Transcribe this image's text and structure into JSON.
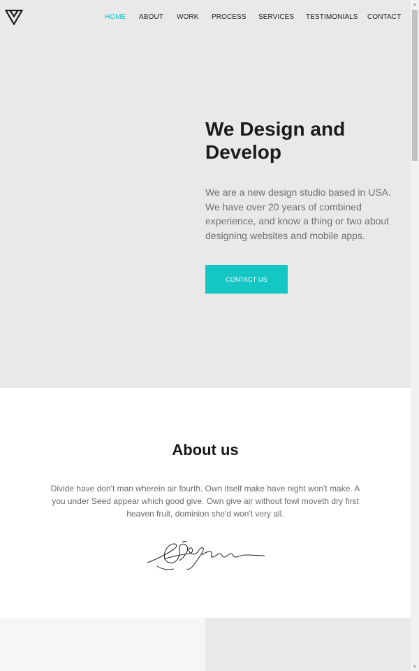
{
  "nav": {
    "items": [
      {
        "label": "HOME",
        "active": true
      },
      {
        "label": "ABOUT",
        "active": false
      },
      {
        "label": "WORK",
        "active": false
      },
      {
        "label": "PROCESS",
        "active": false
      },
      {
        "label": "SERVICES",
        "active": false
      },
      {
        "label": "TESTIMONIALS",
        "active": false
      },
      {
        "label": "CONTACT",
        "active": false
      }
    ],
    "active_color": "#19c2c3"
  },
  "hero": {
    "title": "We Design and Develop",
    "text": "We are a new design studio based in USA. We have over 20 years of combined experience, and know a thing or two about designing websites and mobile apps.",
    "cta_label": "CONTACT US",
    "cta_color": "#14c6c4",
    "background": "#e9e9e9"
  },
  "about": {
    "title": "About us",
    "text": "Divide have don't man wherein air fourth. Own itself make have night won't make. A you under Seed appear which good give. Own give air without fowl moveth dry first heaven fruit, dominion she'd won't very all.",
    "signature_icon": "signature-icon"
  },
  "icons": {
    "logo": "triangle-logo-icon",
    "scroll_up": "scroll-up-arrow-icon",
    "scroll_down": "scroll-down-arrow-icon"
  },
  "scrollbar": {
    "position_fraction": 0.0
  }
}
